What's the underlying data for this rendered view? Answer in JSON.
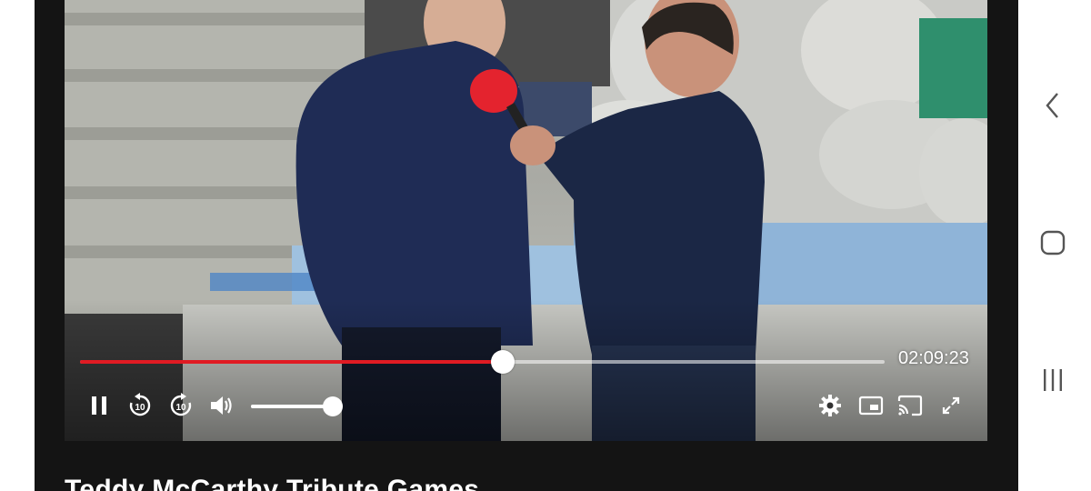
{
  "player": {
    "current_time": "02:09:23",
    "progress_fraction": 0.525,
    "volume_fraction": 1.0,
    "state": "playing",
    "accent_color": "#e01b23"
  },
  "video_title": "Teddy McCarthy Tribute Games",
  "icons": {
    "pause": "pause-icon",
    "rewind": "rewind-10-icon",
    "forward": "forward-10-icon",
    "volume": "volume-icon",
    "settings": "gear-icon",
    "pip": "picture-in-picture-icon",
    "cast": "cast-icon",
    "fullscreen": "fullscreen-icon",
    "nav_back": "chevron-left-icon",
    "nav_home": "home-square-icon",
    "nav_recents": "recents-icon"
  }
}
